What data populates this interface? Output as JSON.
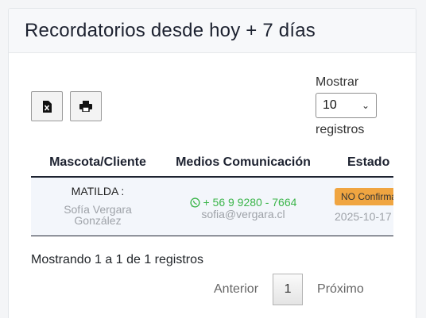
{
  "header": {
    "title": "Recordatorios desde hoy + 7 días"
  },
  "toolbar": {
    "excel_icon": "excel-file-icon",
    "print_icon": "printer-icon"
  },
  "length_menu": {
    "before": "Mostrar",
    "value": "10",
    "after": "registros"
  },
  "table": {
    "columns": [
      "Mascota/Cliente",
      "Medios Comunicación",
      "Estado"
    ],
    "rows": [
      {
        "pet": "MATILDA :",
        "owner_line1": "Sofía Vergara",
        "owner_line2": "González",
        "phone": "+ 56 9 9280 - 7664",
        "email": "sofia@vergara.cl",
        "status": "NO Confirmado",
        "date": "2025-10-17"
      }
    ]
  },
  "info": "Mostrando 1 a 1 de 1 registros",
  "pagination": {
    "prev": "Anterior",
    "page": "1",
    "next": "Próximo"
  },
  "colors": {
    "phone": "#3bb54a",
    "badge": "#f0a541",
    "row_bg": "#f3f6fb"
  }
}
